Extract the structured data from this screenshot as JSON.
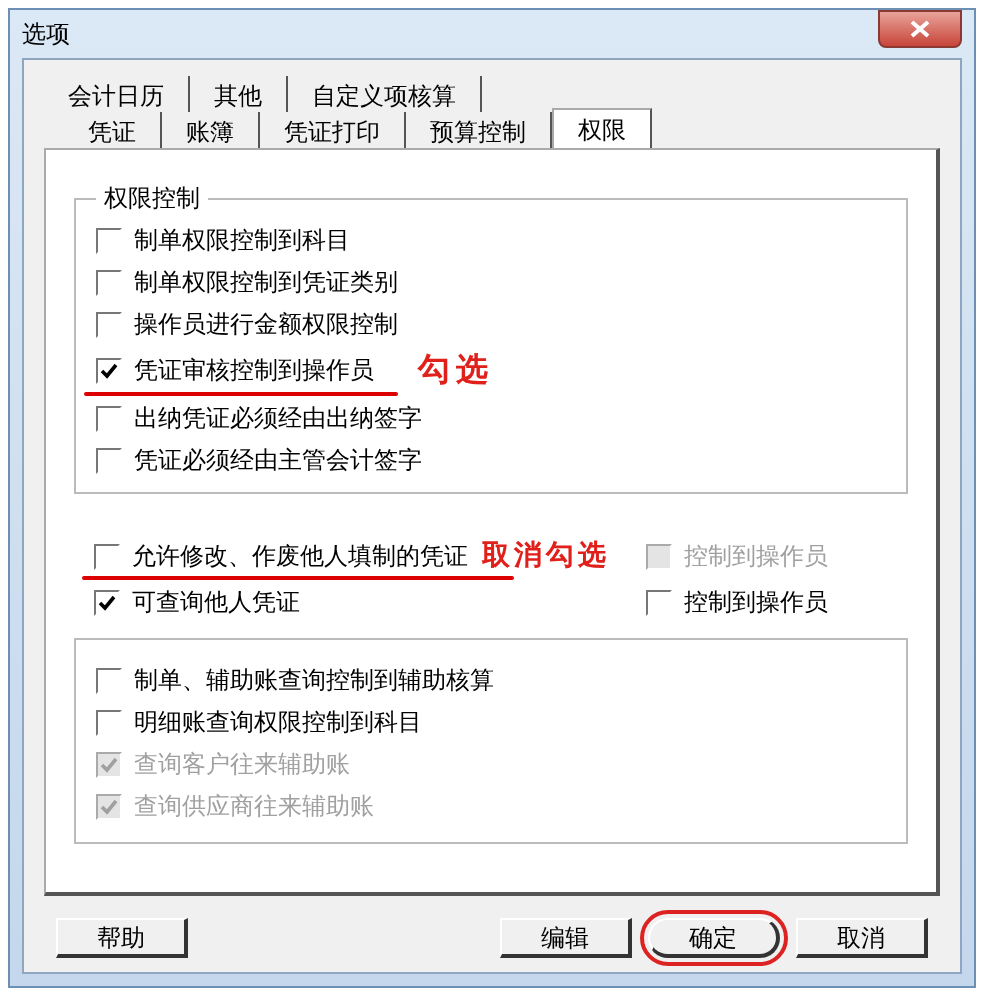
{
  "window": {
    "title": "选项"
  },
  "tab_rows": [
    {
      "tabs": [
        {
          "label": "会计日历",
          "selected": false
        },
        {
          "label": "其他",
          "selected": false
        },
        {
          "label": "自定义项核算",
          "selected": false
        }
      ]
    },
    {
      "tabs": [
        {
          "label": "凭证",
          "selected": false
        },
        {
          "label": "账簿",
          "selected": false
        },
        {
          "label": "凭证打印",
          "selected": false
        },
        {
          "label": "预算控制",
          "selected": false
        },
        {
          "label": "权限",
          "selected": true
        }
      ]
    }
  ],
  "permission_group": {
    "title": "权限控制",
    "options": [
      {
        "label": "制单权限控制到科目",
        "checked": false,
        "disabled": false,
        "underlined": false
      },
      {
        "label": "制单权限控制到凭证类别",
        "checked": false,
        "disabled": false,
        "underlined": false
      },
      {
        "label": "操作员进行金额权限控制",
        "checked": false,
        "disabled": false,
        "underlined": false
      },
      {
        "label": "凭证审核控制到操作员",
        "checked": true,
        "disabled": false,
        "underlined": true,
        "annotation": "勾选"
      },
      {
        "label": "出纳凭证必须经由出纳签字",
        "checked": false,
        "disabled": false,
        "underlined": false
      },
      {
        "label": "凭证必须经由主管会计签字",
        "checked": false,
        "disabled": false,
        "underlined": false
      }
    ]
  },
  "voucher_options": [
    {
      "left": {
        "label": "允许修改、作废他人填制的凭证",
        "checked": false,
        "disabled": false,
        "underlined": true,
        "annotation": "取消勾选"
      },
      "right": {
        "label": "控制到操作员",
        "checked": false,
        "disabled": true,
        "underlined": false
      }
    },
    {
      "left": {
        "label": "可查询他人凭证",
        "checked": true,
        "disabled": false,
        "underlined": false
      },
      "right": {
        "label": "控制到操作员",
        "checked": false,
        "disabled": false,
        "underlined": false
      }
    }
  ],
  "query_group": {
    "options": [
      {
        "label": "制单、辅助账查询控制到辅助核算",
        "checked": false,
        "disabled": false,
        "underlined": false
      },
      {
        "label": "明细账查询权限控制到科目",
        "checked": false,
        "disabled": false,
        "underlined": false
      },
      {
        "label": "查询客户往来辅助账",
        "checked": true,
        "disabled": true,
        "underlined": false
      },
      {
        "label": "查询供应商往来辅助账",
        "checked": true,
        "disabled": true,
        "underlined": false
      }
    ]
  },
  "buttons": [
    {
      "label": "帮助",
      "circled": false
    },
    {
      "label": "编辑",
      "circled": false
    },
    {
      "label": "确定",
      "circled": true
    },
    {
      "label": "取消",
      "circled": false
    }
  ]
}
